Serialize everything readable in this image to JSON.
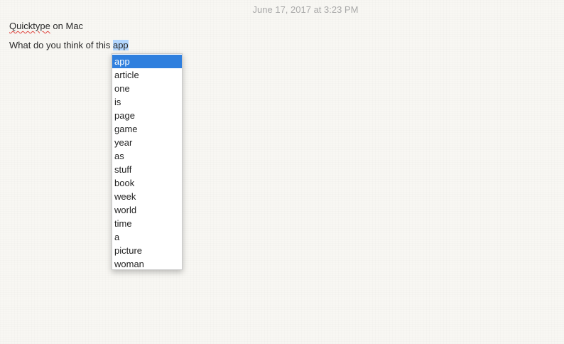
{
  "note": {
    "timestamp": "June 17, 2017 at 3:23 PM",
    "title_word_misspelled": "Quicktype",
    "title_rest": " on Mac",
    "sentence_prefix": "What do you think of this ",
    "selected_word": "app"
  },
  "suggestions": {
    "selected_index": 0,
    "items": [
      "app",
      "article",
      "one",
      "is",
      "page",
      "game",
      "year",
      "as",
      "stuff",
      "book",
      "week",
      "world",
      "time",
      "a",
      "picture",
      "woman"
    ]
  },
  "colors": {
    "selection_highlight": "#2f7fde",
    "word_highlight": "#b3d7ff",
    "spelling_underline": "#e0443e"
  }
}
